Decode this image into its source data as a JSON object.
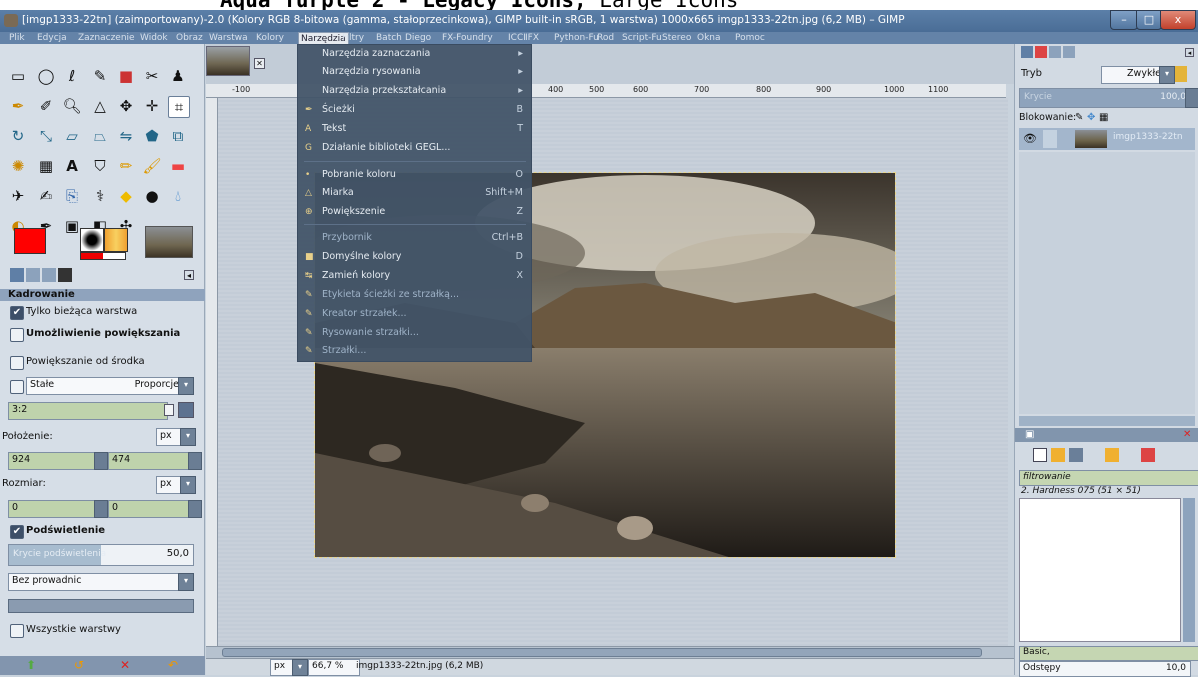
{
  "caption": {
    "bold": "Aqua Turple 2 - Legacy Icons,",
    "normal": " Large Icons"
  },
  "window": {
    "title": "[imgp1333-22tn] (zaimportowany)-2.0 (Kolory RGB 8-bitowa (gamma, stałoprzecinkowa), GIMP built-in sRGB, 1 warstwa) 1000x665 imgp1333-22tn.jpg (6,2 MB) – GIMP",
    "minimize": "–",
    "maximize": "□",
    "close": "x"
  },
  "menubar": [
    "Plik",
    "Edycja",
    "Zaznaczenie",
    "Widok",
    "Obraz",
    "Warstwa",
    "Kolory",
    "Narzędzia",
    "Filtry",
    "Batch",
    "Diego",
    "FX-Foundry",
    "ICCⅡFX",
    "Python-Fu",
    "Rod",
    "Script-Fu",
    "Stereo",
    "Okna",
    "Pomoc"
  ],
  "tools_menu": {
    "items": [
      {
        "label": "Narzędzia zaznaczania",
        "key": "▸"
      },
      {
        "label": "Narzędzia rysowania",
        "key": "▸"
      },
      {
        "label": "Narzędzia przekształcania",
        "key": "▸"
      },
      {
        "label": "Ścieżki",
        "key": "B"
      },
      {
        "label": "Tekst",
        "key": "T"
      },
      {
        "label": "Działanie biblioteki GEGL...",
        "key": ""
      },
      {
        "label": "Pobranie koloru",
        "key": "O"
      },
      {
        "label": "Miarka",
        "key": "Shift+M"
      },
      {
        "label": "Powiększenie",
        "key": "Z"
      },
      {
        "label": "Przybornik",
        "key": "Ctrl+B"
      },
      {
        "label": "Domyślne kolory",
        "key": "D"
      },
      {
        "label": "Zamień kolory",
        "key": "X"
      },
      {
        "label": "Etykieta ścieżki ze strzałką...",
        "key": ""
      },
      {
        "label": "Kreator strzałek...",
        "key": ""
      },
      {
        "label": "Rysowanie strzałki...",
        "key": ""
      },
      {
        "label": "Strzałki...",
        "key": ""
      }
    ]
  },
  "tool_options": {
    "title": "Kadrowanie",
    "only_current_layer": "Tylko bieżąca warstwa",
    "allow_growing": "Umożliwienie powiększania",
    "expand_from_center": "Powiększanie od środka",
    "fixed": "Stałe",
    "fixed_mode": "Proporcje",
    "ratio": "3:2",
    "position_label": "Położenie:",
    "unit": "px",
    "pos_x": "924",
    "pos_y": "474",
    "size_label": "Rozmiar:",
    "size_w": "0",
    "size_h": "0",
    "highlight": "Podświetlenie",
    "highlight_opacity_label": "Krycie podświetlenia",
    "highlight_opacity": "50,0",
    "guides": "Bez prowadnic",
    "all_layers": "Wszystkie warstwy"
  },
  "ruler": [
    "-100",
    "400",
    "500",
    "600",
    "700",
    "800",
    "900",
    "1000",
    "1100"
  ],
  "status": {
    "unit": "px",
    "zoom": "66,7 %",
    "info": "imgp1333-22tn.jpg (6,2 MB)"
  },
  "layers": {
    "mode_label": "Tryb",
    "mode_value": "Zwykłe",
    "opacity_label": "Krycie",
    "opacity_value": "100,0",
    "lock_label": "Blokowanie:",
    "layer_name": "imgp1333-22tn"
  },
  "brushes": {
    "filter_placeholder": "filtrowanie",
    "brush_name": "2. Hardness 075 (51 × 51)",
    "preset": "Basic,",
    "spacing_label": "Odstępy",
    "spacing_value": "10,0"
  }
}
